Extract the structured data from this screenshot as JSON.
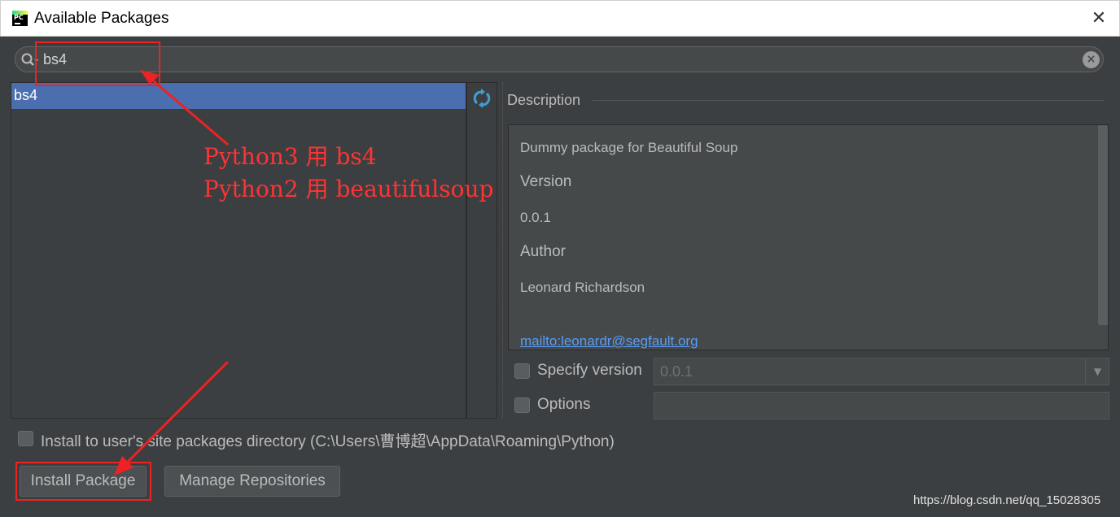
{
  "window": {
    "title": "Available Packages",
    "close_glyph": "✕"
  },
  "search": {
    "value": "bs4",
    "icon": "search-icon",
    "clear_glyph": "×"
  },
  "packages": {
    "items": [
      {
        "name": "bs4",
        "selected": true
      }
    ]
  },
  "description": {
    "label": "Description",
    "summary": "Dummy package for Beautiful Soup",
    "version_heading": "Version",
    "version_value": "0.0.1",
    "author_heading": "Author",
    "author_value": "Leonard Richardson",
    "mailto": "mailto:leonardr@segfault.org"
  },
  "specify_version": {
    "label": "Specify version",
    "value": "0.0.1",
    "checked": false
  },
  "options": {
    "label": "Options",
    "value": "",
    "checked": false
  },
  "install_user": {
    "label": "Install to user's site packages directory (C:\\Users\\曹博超\\AppData\\Roaming\\Python)",
    "checked": false
  },
  "buttons": {
    "install": "Install Package",
    "manage": "Manage Repositories"
  },
  "annotation": {
    "line1": "Python3 用 bs4",
    "line2": "Python2 用 beautifulsoup",
    "color": "#ee2222"
  },
  "watermark": "https://blog.csdn.net/qq_15028305",
  "colors": {
    "background": "#3c3f41",
    "selection": "#4b6eaf",
    "link": "#589df6"
  }
}
